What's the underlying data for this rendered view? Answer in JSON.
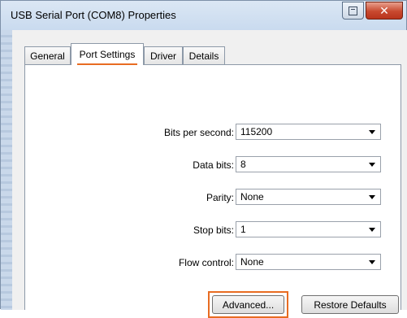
{
  "window": {
    "title": "USB Serial Port (COM8) Properties"
  },
  "tabs": [
    {
      "label": "General"
    },
    {
      "label": "Port Settings"
    },
    {
      "label": "Driver"
    },
    {
      "label": "Details"
    }
  ],
  "active_tab": "Port Settings",
  "fields": [
    {
      "label": "Bits per second:",
      "value": "115200"
    },
    {
      "label": "Data bits:",
      "value": "8"
    },
    {
      "label": "Parity:",
      "value": "None"
    },
    {
      "label": "Stop bits:",
      "value": "1"
    },
    {
      "label": "Flow control:",
      "value": "None"
    }
  ],
  "buttons": {
    "advanced": "Advanced...",
    "restore_defaults": "Restore Defaults"
  },
  "icons": {
    "restore": "restore-icon",
    "close": "close-icon",
    "dropdown": "chevron-down-icon"
  },
  "colors": {
    "highlight": "#e86c22",
    "close_button": "#c8492f"
  }
}
